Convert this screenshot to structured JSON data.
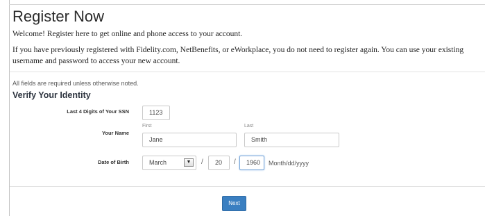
{
  "header": {
    "title": "Register Now"
  },
  "intro": {
    "welcome": "Welcome! Register here to get online and phone access to your account.",
    "line2": "If you have previously registered with Fidelity.com, NetBenefits, or eWorkplace, you do not need to register again. You can use your existing",
    "line3": "username and password to access your new account."
  },
  "form": {
    "required_note": "All fields are required unless otherwise noted.",
    "section_title": "Verify Your Identity",
    "ssn": {
      "label": "Last 4 Digits of Your SSN",
      "value": "1123"
    },
    "name": {
      "label": "Your Name",
      "first_label": "First",
      "first_value": "Jane",
      "last_label": "Last",
      "last_value": "Smith"
    },
    "dob": {
      "label": "Date of Birth",
      "month": "March",
      "day": "20",
      "year": "1960",
      "separator": "/",
      "format_hint": "Month/dd/yyyy"
    },
    "next_label": "Next"
  },
  "icons": {
    "month_select_arrow": "chevron-down-icon"
  },
  "colors": {
    "primary_button": "#3a7fc1",
    "focus_border": "#7aa7d9"
  }
}
